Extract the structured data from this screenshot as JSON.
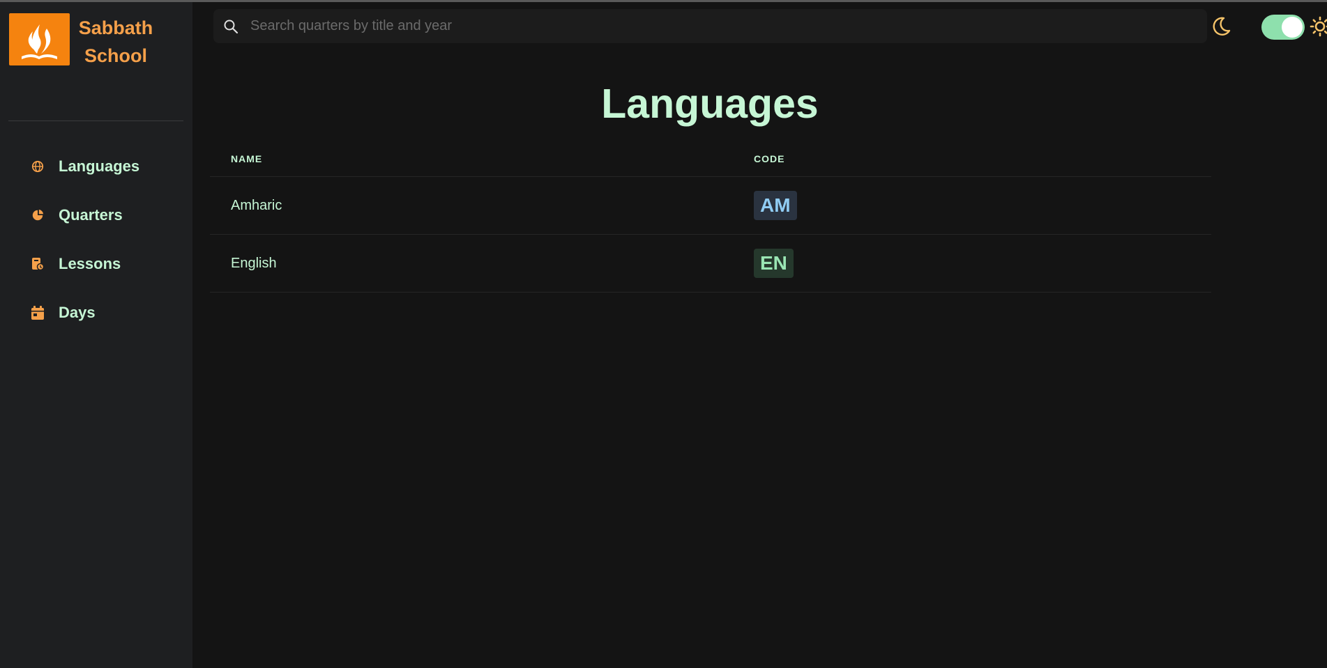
{
  "brand": {
    "line1": "Sabbath",
    "line2": "School"
  },
  "sidebar": {
    "items": [
      {
        "label": "Languages",
        "icon": "globe-icon"
      },
      {
        "label": "Quarters",
        "icon": "pie-chart-icon"
      },
      {
        "label": "Lessons",
        "icon": "lesson-book-icon"
      },
      {
        "label": "Days",
        "icon": "calendar-icon"
      }
    ]
  },
  "search": {
    "placeholder": "Search quarters by title and year",
    "value": ""
  },
  "theme": {
    "mode": "dark",
    "toggle_on": true
  },
  "main": {
    "title": "Languages",
    "table": {
      "headers": [
        "NAME",
        "CODE"
      ],
      "rows": [
        {
          "name": "Amharic",
          "code": "AM"
        },
        {
          "name": "English",
          "code": "EN"
        }
      ]
    }
  },
  "colors": {
    "accent_orange": "#f5830f",
    "brand_text": "#f5a04a",
    "mint_text": "#c6f6d5",
    "toggle_green": "#8ee0ad",
    "badge_am_bg": "#2a3340",
    "badge_am_text": "#90cdf4",
    "badge_en_bg": "#25382c",
    "badge_en_text": "#9ae6b4"
  }
}
